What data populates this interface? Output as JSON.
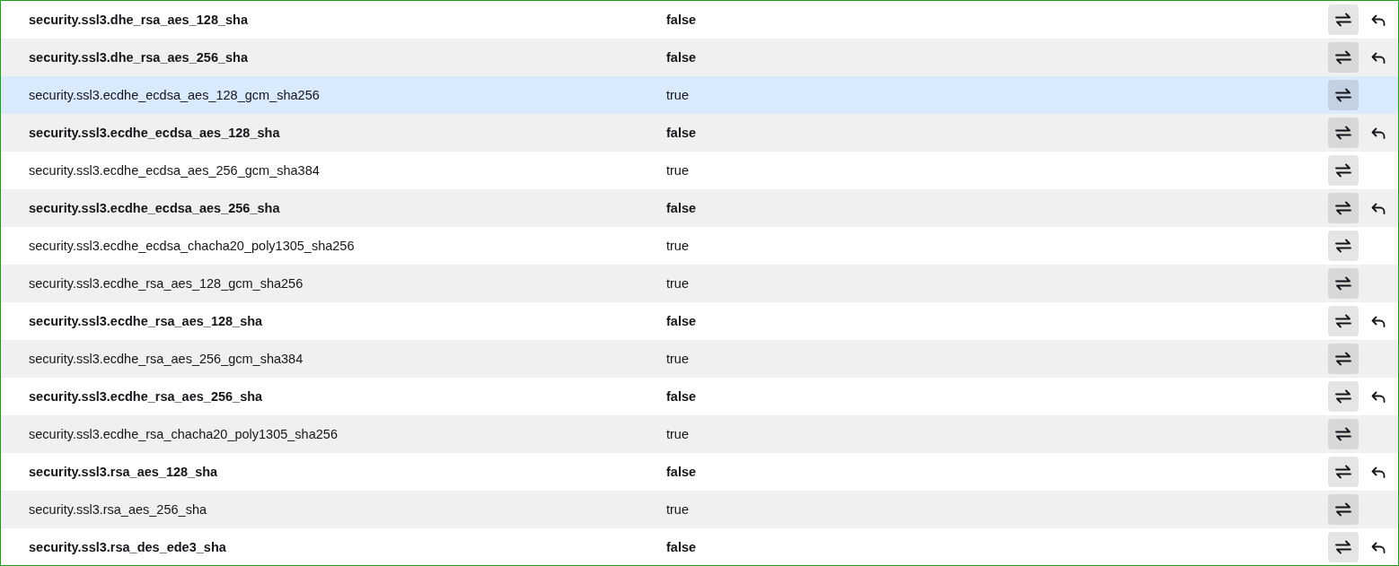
{
  "preferences": [
    {
      "name": "security.ssl3.dhe_rsa_aes_128_sha",
      "value": "false",
      "modified": true,
      "selected": false
    },
    {
      "name": "security.ssl3.dhe_rsa_aes_256_sha",
      "value": "false",
      "modified": true,
      "selected": false
    },
    {
      "name": "security.ssl3.ecdhe_ecdsa_aes_128_gcm_sha256",
      "value": "true",
      "modified": false,
      "selected": true
    },
    {
      "name": "security.ssl3.ecdhe_ecdsa_aes_128_sha",
      "value": "false",
      "modified": true,
      "selected": false
    },
    {
      "name": "security.ssl3.ecdhe_ecdsa_aes_256_gcm_sha384",
      "value": "true",
      "modified": false,
      "selected": false
    },
    {
      "name": "security.ssl3.ecdhe_ecdsa_aes_256_sha",
      "value": "false",
      "modified": true,
      "selected": false
    },
    {
      "name": "security.ssl3.ecdhe_ecdsa_chacha20_poly1305_sha256",
      "value": "true",
      "modified": false,
      "selected": false
    },
    {
      "name": "security.ssl3.ecdhe_rsa_aes_128_gcm_sha256",
      "value": "true",
      "modified": false,
      "selected": false
    },
    {
      "name": "security.ssl3.ecdhe_rsa_aes_128_sha",
      "value": "false",
      "modified": true,
      "selected": false
    },
    {
      "name": "security.ssl3.ecdhe_rsa_aes_256_gcm_sha384",
      "value": "true",
      "modified": false,
      "selected": false
    },
    {
      "name": "security.ssl3.ecdhe_rsa_aes_256_sha",
      "value": "false",
      "modified": true,
      "selected": false
    },
    {
      "name": "security.ssl3.ecdhe_rsa_chacha20_poly1305_sha256",
      "value": "true",
      "modified": false,
      "selected": false
    },
    {
      "name": "security.ssl3.rsa_aes_128_sha",
      "value": "false",
      "modified": true,
      "selected": false
    },
    {
      "name": "security.ssl3.rsa_aes_256_sha",
      "value": "true",
      "modified": false,
      "selected": false
    },
    {
      "name": "security.ssl3.rsa_des_ede3_sha",
      "value": "false",
      "modified": true,
      "selected": false
    }
  ]
}
